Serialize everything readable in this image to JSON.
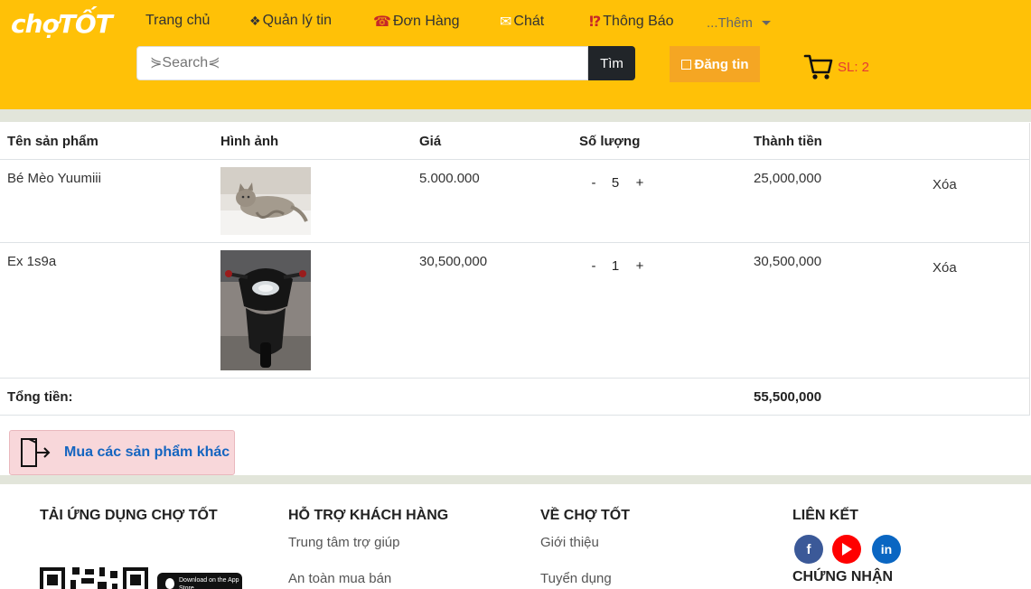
{
  "header": {
    "logo": "chợTỐT",
    "nav": [
      {
        "label": "Trang chủ",
        "icon": ""
      },
      {
        "label": "Quản lý tin",
        "icon": "❖"
      },
      {
        "label": "Đơn Hàng",
        "icon": "☎"
      },
      {
        "label": "Chát",
        "icon": "✉"
      },
      {
        "label": "Thông Báo",
        "icon": "⁉"
      },
      {
        "label": "...Thêm",
        "icon": ""
      }
    ],
    "search_placeholder": "⋟Search⋞",
    "search_button": "Tìm",
    "post_button": "Đăng tin",
    "cart_count": "SL: 2"
  },
  "table": {
    "headers": [
      "Tên sản phẩm",
      "Hình ảnh",
      "Giá",
      "Số lượng",
      "Thành tiền"
    ],
    "rows": [
      {
        "name": "Bé Mèo Yuumiii",
        "price": "5.000.000",
        "qty": "5",
        "total": "25,000,000",
        "remove": "Xóa"
      },
      {
        "name": "Ex 1s9a",
        "price": "30,500,000",
        "qty": "1",
        "total": "30,500,000",
        "remove": "Xóa"
      }
    ],
    "minus": "-",
    "plus": "+",
    "sum_label": "Tổng tiền:",
    "sum_value": "55,500,000"
  },
  "continue_button": "Mua các sản phẩm khác",
  "footer": {
    "app_title": "TẢI ỨNG DỤNG CHỢ TỐT",
    "app_store": "Download on the App Store",
    "support_title": "HỖ TRỢ KHÁCH HÀNG",
    "support_links": [
      "Trung tâm trợ giúp",
      "An toàn mua bán"
    ],
    "about_title": "VỀ CHỢ TỐT",
    "about_links": [
      "Giới thiệu",
      "Tuyển dụng"
    ],
    "links_title": "LIÊN KẾT",
    "cert_title": "CHỨNG NHẬN"
  },
  "colors": {
    "header": "#ffc107",
    "post_button": "#f5a623",
    "facebook": "#3b5998",
    "youtube": "#ff0000",
    "linkedin": "#0a66c2"
  }
}
